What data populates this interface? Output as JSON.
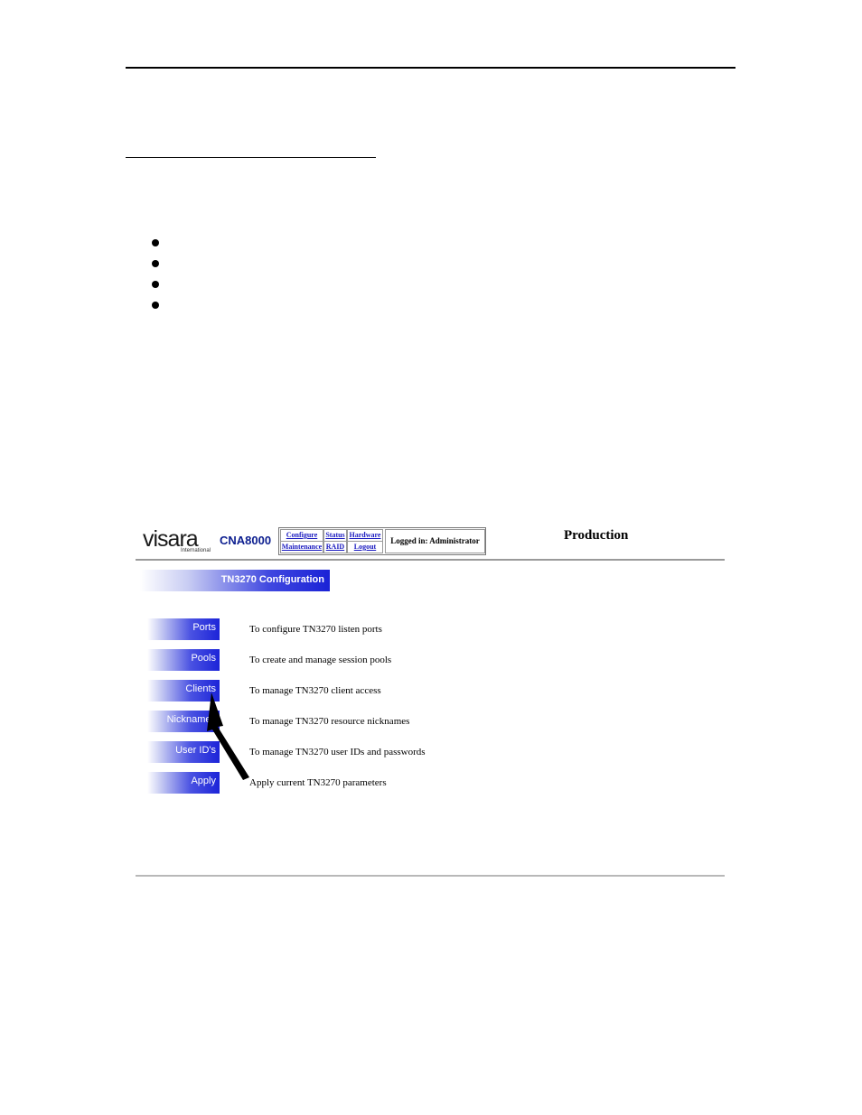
{
  "app": {
    "logo_text": "visara",
    "logo_subtext": "International",
    "product": "CNA8000",
    "environment": "Production"
  },
  "nav": {
    "row1": [
      "Configure",
      "Status",
      "Hardware"
    ],
    "row2": [
      "Maintenance",
      "RAID",
      "Logout"
    ],
    "logged_in": "Logged in: Administrator"
  },
  "section_title": "TN3270 Configuration",
  "menu": [
    {
      "label": "Ports",
      "description": "To configure TN3270 listen ports"
    },
    {
      "label": "Pools",
      "description": "To create and manage session pools"
    },
    {
      "label": "Clients",
      "description": "To manage TN3270 client access"
    },
    {
      "label": "Nicknames",
      "description": "To manage TN3270 resource nicknames"
    },
    {
      "label": "User ID's",
      "description": "To manage TN3270 user IDs and passwords"
    },
    {
      "label": "Apply",
      "description": "Apply current TN3270 parameters"
    }
  ],
  "colors": {
    "accent": "#1a22d6",
    "product": "#0b1d8f"
  },
  "icons": {
    "pointer": "arrow-icon",
    "bullet": "bullet-icon"
  }
}
